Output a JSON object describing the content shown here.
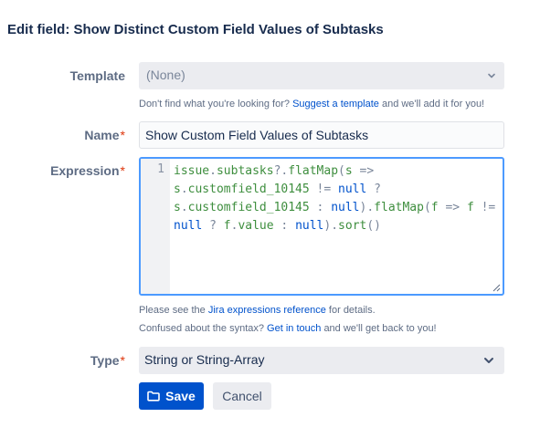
{
  "dialog": {
    "title": "Edit field: Show Distinct Custom Field Values of Subtasks"
  },
  "template": {
    "label": "Template",
    "value": "(None)",
    "help_prefix": "Don't find what you're looking for?",
    "help_link": "Suggest a template",
    "help_suffix": "and we'll add it for you!"
  },
  "name": {
    "label": "Name",
    "required_mark": "*",
    "value": "Show Custom Field Values of Subtasks"
  },
  "expression": {
    "label": "Expression",
    "required_mark": "*",
    "line_number": "1",
    "code_lines": [
      "issue.subtasks?.flatMap(s =>",
      "s.customfield_10145 != null ?",
      "s.customfield_10145 : null).flatMap(f => f !=",
      "null ? f.value : null).sort()"
    ],
    "help1_prefix": "Please see the",
    "help1_link": "Jira expressions reference",
    "help1_suffix": "for details.",
    "help2_prefix": "Confused about the syntax?",
    "help2_link": "Get in touch",
    "help2_suffix": "and we'll get back to you!"
  },
  "type": {
    "label": "Type",
    "required_mark": "*",
    "value": "String or String-Array"
  },
  "actions": {
    "save_label": "Save",
    "cancel_label": "Cancel"
  },
  "colors": {
    "primary": "#0052cc",
    "focus_border": "#4c9aff",
    "required": "#de350b",
    "code_keyword": "#0052cc",
    "code_text": "#3e8e3e",
    "code_operator": "#7a869a"
  },
  "icons": {
    "template_chevron": "chevron-down-icon",
    "type_chevron": "chevron-down-icon",
    "save_icon": "folder-icon"
  }
}
